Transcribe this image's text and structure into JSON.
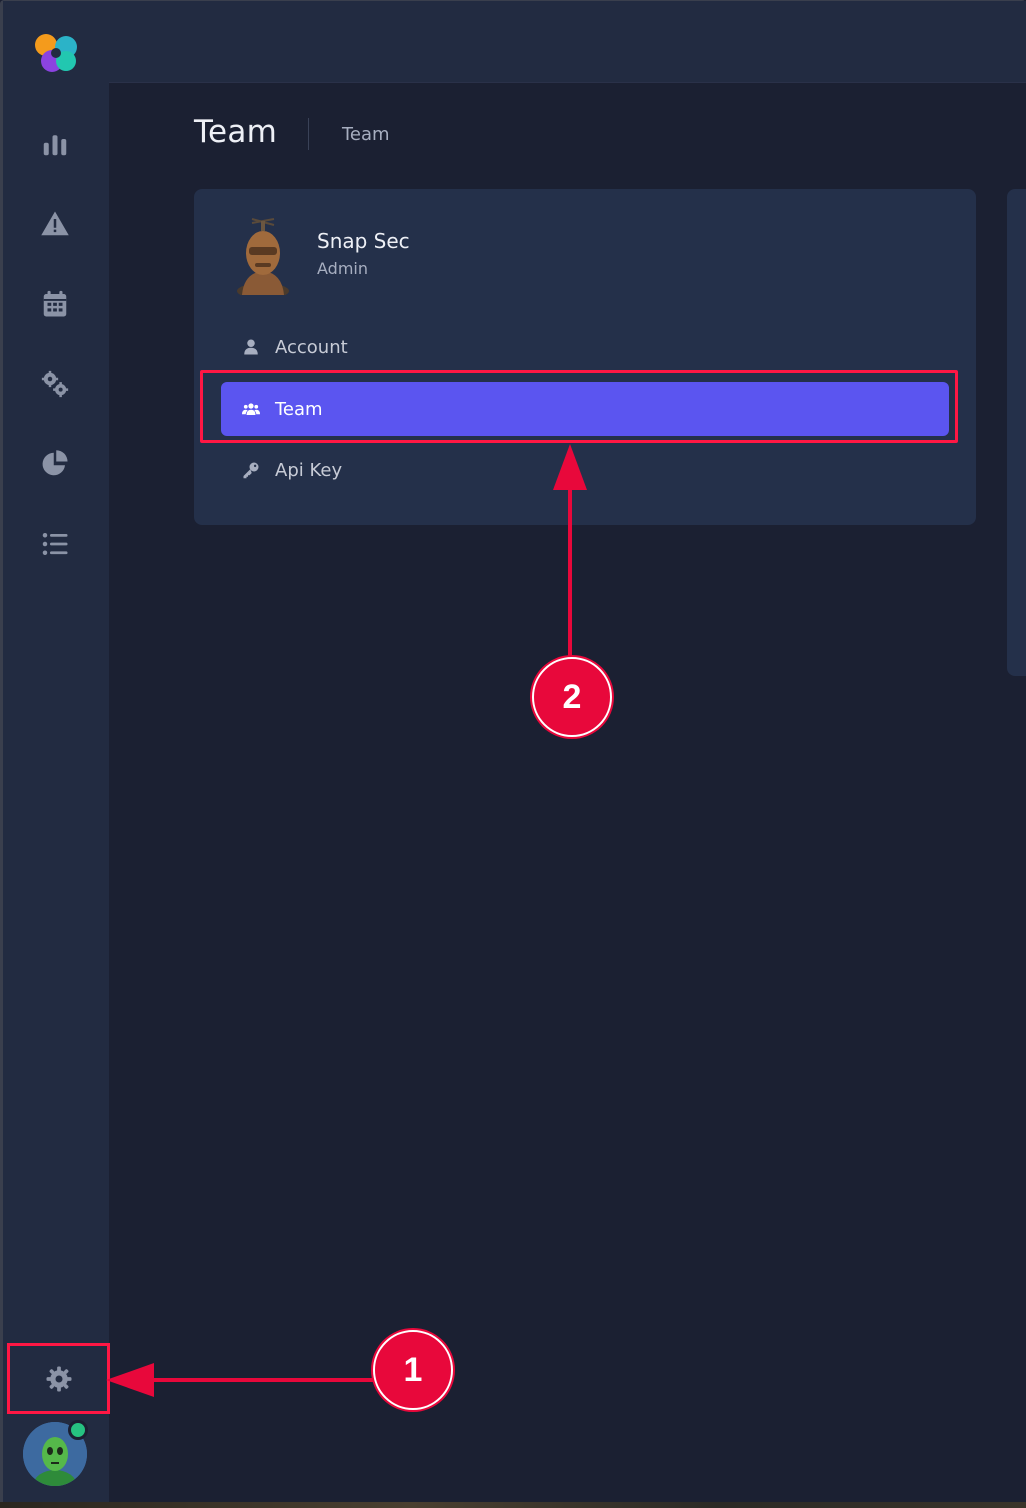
{
  "header": {
    "page_title": "Team",
    "breadcrumb": "Team"
  },
  "sidebar": {
    "nav_items": [
      {
        "name": "dashboard",
        "icon": "bar-chart-icon"
      },
      {
        "name": "alerts",
        "icon": "warning-icon"
      },
      {
        "name": "calendar",
        "icon": "calendar-icon"
      },
      {
        "name": "integrations",
        "icon": "cogs-icon"
      },
      {
        "name": "reports",
        "icon": "pie-chart-icon"
      },
      {
        "name": "list",
        "icon": "list-icon"
      }
    ],
    "settings_icon": "gear-icon",
    "user_status": "online"
  },
  "profile": {
    "name": "Snap Sec",
    "role": "Admin"
  },
  "menu": {
    "account_label": "Account",
    "team_label": "Team",
    "api_key_label": "Api Key",
    "active": "Team"
  },
  "annotations": {
    "step1": "1",
    "step2": "2",
    "color": "#e8083b"
  },
  "colors": {
    "accent": "#5b55f0",
    "background": "#1b2032",
    "panel": "#24304a",
    "highlight": "#ff1744"
  }
}
